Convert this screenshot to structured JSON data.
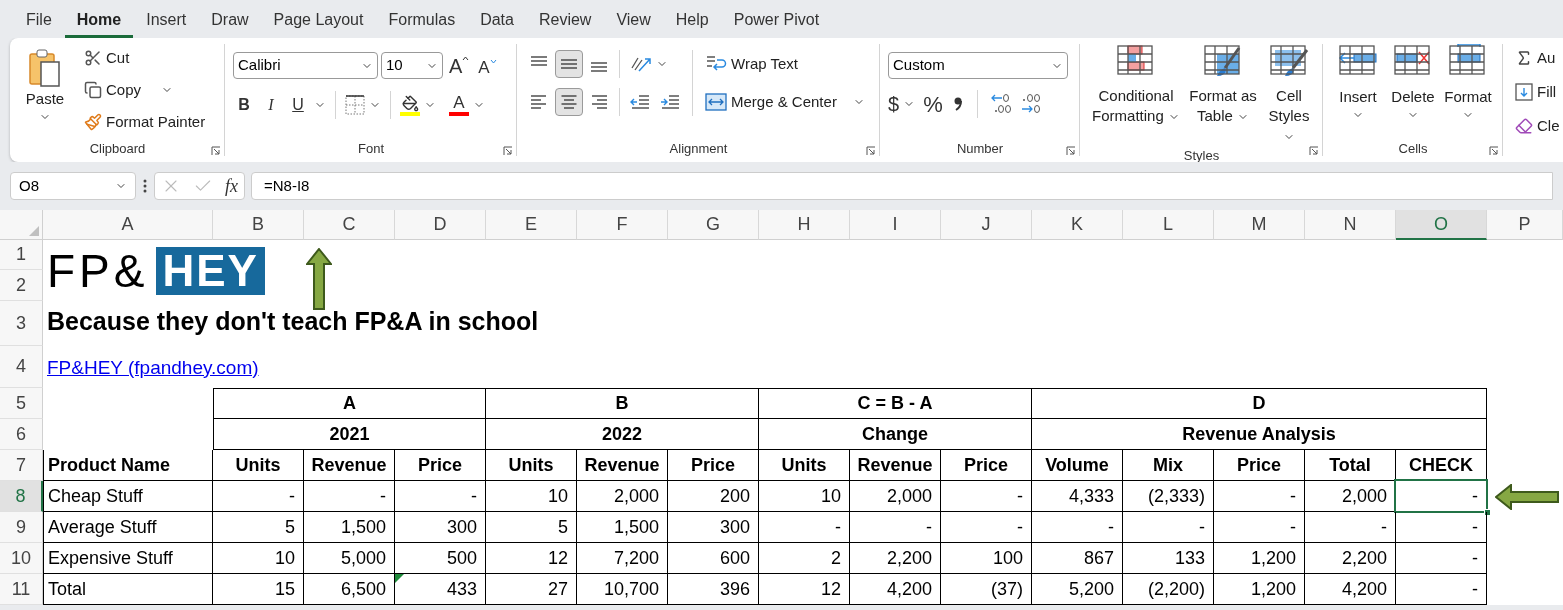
{
  "menu_tabs": [
    {
      "label": "File",
      "selected": false
    },
    {
      "label": "Home",
      "selected": true
    },
    {
      "label": "Insert",
      "selected": false
    },
    {
      "label": "Draw",
      "selected": false
    },
    {
      "label": "Page Layout",
      "selected": false
    },
    {
      "label": "Formulas",
      "selected": false
    },
    {
      "label": "Data",
      "selected": false
    },
    {
      "label": "Review",
      "selected": false
    },
    {
      "label": "View",
      "selected": false
    },
    {
      "label": "Help",
      "selected": false
    },
    {
      "label": "Power Pivot",
      "selected": false
    }
  ],
  "ribbon": {
    "clipboard": {
      "label": "Clipboard",
      "paste": "Paste",
      "cut": "Cut",
      "copy": "Copy",
      "format_painter": "Format Painter"
    },
    "font": {
      "label": "Font",
      "font_name": "Calibri",
      "font_size": "10",
      "grow": "A",
      "shrink": "A",
      "bold": "B",
      "italic": "I",
      "underline": "U",
      "font_color": "A"
    },
    "alignment": {
      "label": "Alignment",
      "vertical": [
        {
          "selected": false
        },
        {
          "selected": true
        },
        {
          "selected": false
        }
      ],
      "horizontal": [
        {
          "selected": false
        },
        {
          "selected": true
        },
        {
          "selected": false
        }
      ],
      "wrap_text": "Wrap Text",
      "merge_center": "Merge & Center"
    },
    "number": {
      "label": "Number",
      "format": "Custom",
      "currency": "$",
      "percent": "%"
    },
    "styles": {
      "label": "Styles",
      "buttons": [
        "Conditional Formatting",
        "Format as Table",
        "Cell Styles"
      ]
    },
    "cells": {
      "label": "Cells",
      "buttons": [
        "Insert",
        "Delete",
        "Format"
      ]
    },
    "editing": {
      "autosum": "Au",
      "fill": "Fill",
      "clear": "Cle"
    }
  },
  "formula_bar": {
    "name_box": "O8",
    "fx": "fx",
    "formula": "=N8-I8"
  },
  "sheet": {
    "columns": [
      {
        "label": "A",
        "selected": false
      },
      {
        "label": "B",
        "selected": false
      },
      {
        "label": "C",
        "selected": false
      },
      {
        "label": "D",
        "selected": false
      },
      {
        "label": "E",
        "selected": false
      },
      {
        "label": "F",
        "selected": false
      },
      {
        "label": "G",
        "selected": false
      },
      {
        "label": "H",
        "selected": false
      },
      {
        "label": "I",
        "selected": false
      },
      {
        "label": "J",
        "selected": false
      },
      {
        "label": "K",
        "selected": false
      },
      {
        "label": "L",
        "selected": false
      },
      {
        "label": "M",
        "selected": false
      },
      {
        "label": "N",
        "selected": false
      },
      {
        "label": "O",
        "selected": true
      },
      {
        "label": "P",
        "selected": false
      }
    ],
    "rows": [
      {
        "label": "1",
        "selected": false
      },
      {
        "label": "2",
        "selected": false
      },
      {
        "label": "3",
        "selected": false
      },
      {
        "label": "4",
        "selected": false
      },
      {
        "label": "5",
        "selected": false
      },
      {
        "label": "6",
        "selected": false
      },
      {
        "label": "7",
        "selected": false
      },
      {
        "label": "8",
        "selected": true
      },
      {
        "label": "9",
        "selected": false
      },
      {
        "label": "10",
        "selected": false
      },
      {
        "label": "11",
        "selected": false
      }
    ],
    "logo": {
      "text": "FP&",
      "badge": "HEY"
    },
    "tagline": "Because they don't teach FP&A in school",
    "link": "FP&HEY (fpandhey.com)",
    "table": {
      "first_column": "Product Name",
      "groups": [
        {
          "label": "A",
          "sublabel": "2021",
          "columns": [
            "Units",
            "Revenue",
            "Price"
          ]
        },
        {
          "label": "B",
          "sublabel": "2022",
          "columns": [
            "Units",
            "Revenue",
            "Price"
          ]
        },
        {
          "label": "C = B - A",
          "sublabel": "Change",
          "columns": [
            "Units",
            "Revenue",
            "Price"
          ]
        },
        {
          "label": "D",
          "sublabel": "Revenue Analysis",
          "columns": [
            "Volume",
            "Mix",
            "Price",
            "Total",
            "CHECK"
          ]
        }
      ],
      "rows": [
        [
          "Cheap Stuff",
          "-",
          "-",
          "-",
          "10",
          "2,000",
          "200",
          "10",
          "2,000",
          "-",
          "4,333",
          "(2,333)",
          "-",
          "2,000",
          "-"
        ],
        [
          "Average Stuff",
          "5",
          "1,500",
          "300",
          "5",
          "1,500",
          "300",
          "-",
          "-",
          "-",
          "-",
          "-",
          "-",
          "-",
          "-"
        ],
        [
          "Expensive Stuff",
          "10",
          "5,000",
          "500",
          "12",
          "7,200",
          "600",
          "2",
          "2,200",
          "100",
          "867",
          "133",
          "1,200",
          "2,200",
          "-"
        ],
        [
          "Total",
          "15",
          "6,500",
          {
            "text": "433",
            "warning": true
          },
          "27",
          "10,700",
          "396",
          "12",
          "4,200",
          "(37)",
          "5,200",
          "(2,200)",
          "1,200",
          "4,200",
          "-"
        ]
      ]
    }
  }
}
